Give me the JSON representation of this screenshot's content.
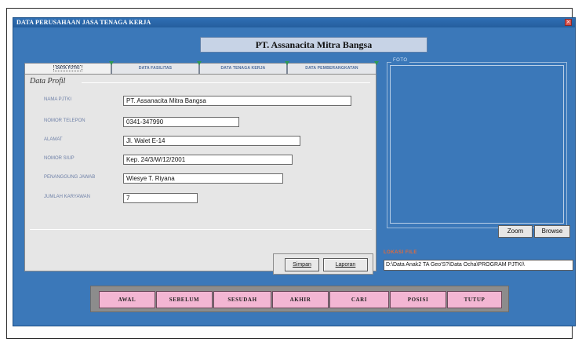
{
  "window": {
    "title": "DATA PERUSAHAAN JASA TENAGA KERJA",
    "close_glyph": "×"
  },
  "company_name": "PT. Assanacita Mitra Bangsa",
  "tabs": [
    {
      "label": "DATA PJTKI",
      "active": true
    },
    {
      "label": "DATA FASILITAS",
      "active": false
    },
    {
      "label": "DATA TENAGA KERJA",
      "active": false
    },
    {
      "label": "DATA PEMBERANGKATAN",
      "active": false
    }
  ],
  "profile": {
    "section_title": "Data Profil",
    "fields": [
      {
        "label": "NAMA PJTKI",
        "value": "PT. Assanacita Mitra Bangsa"
      },
      {
        "label": "NOMOR TELEPON",
        "value": "0341-347990"
      },
      {
        "label": "ALAMAT",
        "value": "Jl. Walet E-14"
      },
      {
        "label": "NOMOR SIUP",
        "value": "Kep. 24/3/W/12/2001"
      },
      {
        "label": "PENANGGUNG JAWAB",
        "value": "Wiesye T. Riyana"
      },
      {
        "label": "JUMLAH KARYAWAN",
        "value": "7"
      }
    ],
    "buttons": {
      "save": "Simpan",
      "report": "Laporan"
    }
  },
  "photo": {
    "label": "FOTO",
    "zoom_label": "Zoom",
    "browse_label": "Browse",
    "location_label": "LOKASI FILE",
    "location_value": "D:\\Data Anak2 TA Geo'S?\\Data Ocha\\PROGRAM PJTKI\\"
  },
  "navigation": [
    {
      "label": "AWAL"
    },
    {
      "label": "SEBELUM"
    },
    {
      "label": "SESUDAH"
    },
    {
      "label": "AKHIR"
    },
    {
      "label": "CARI"
    },
    {
      "label": "POSISI"
    },
    {
      "label": "TUTUP"
    }
  ],
  "colors": {
    "window_bg": "#3b78b9",
    "nav_button": "#f3b6d3",
    "lokasi_label": "#e26a3a",
    "field_label": "#6f81a8"
  }
}
